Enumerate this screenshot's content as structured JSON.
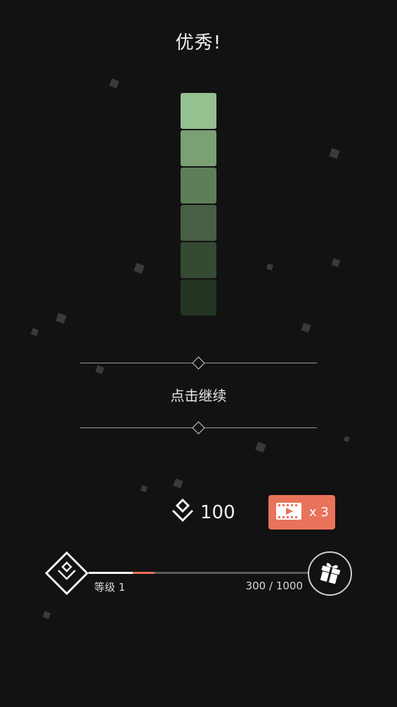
{
  "result": {
    "title": "优秀!"
  },
  "puzzle": {
    "swatches": [
      "#95c08f",
      "#7aa074",
      "#5d7f58",
      "#475f44",
      "#344a33",
      "#233423"
    ]
  },
  "prompt": {
    "continue_label": "点击继续"
  },
  "currency": {
    "icon": "gem-stack-icon",
    "amount": "100"
  },
  "video_reward": {
    "icon": "film-play-icon",
    "multiplier": "x 3",
    "color": "#e8735a"
  },
  "progress": {
    "level_icon": "level-diamond-icon",
    "level_label": "等级 1",
    "xp_label": "300 / 1000",
    "xp_current": 300,
    "xp_gain": 100,
    "xp_max": 1000,
    "gift_icon": "gift-icon"
  }
}
